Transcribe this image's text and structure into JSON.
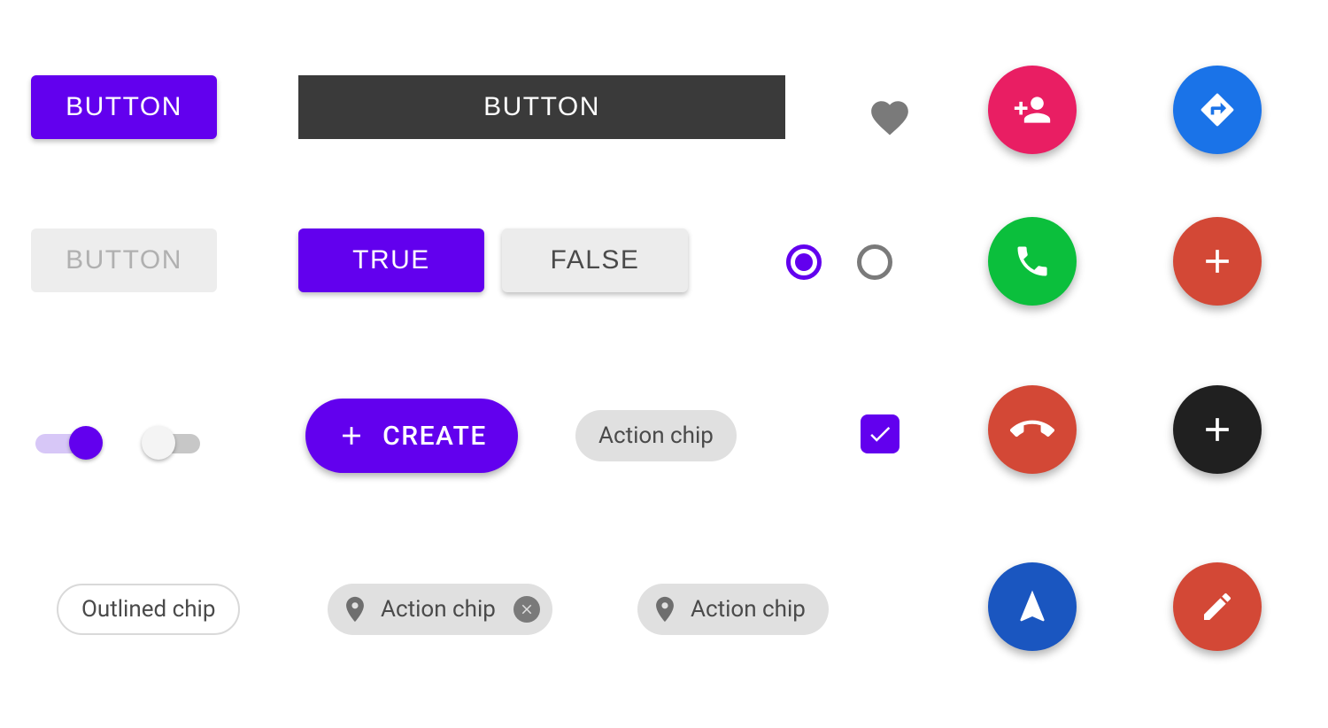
{
  "colors": {
    "primary": "#6200ee",
    "dark": "#3a3a3a",
    "disabledBg": "#ededed",
    "disabledFg": "#b0b0b0",
    "chip": "#e0e0e0",
    "pink": "#e91e63",
    "blue": "#1a73e8",
    "green": "#0bbf3c",
    "red": "#d34836",
    "black": "#202020",
    "navy": "#1a56c0",
    "grey": "#7a7a7a"
  },
  "row1": {
    "button_contained": "BUTTON",
    "button_dark": "BUTTON"
  },
  "row2": {
    "button_disabled": "BUTTON",
    "segment_true": "TRUE",
    "segment_false": "FALSE"
  },
  "row3": {
    "create_label": "CREATE",
    "action_chip": "Action chip",
    "switch_on": true,
    "switch_off": false,
    "checkbox_checked": true
  },
  "row4": {
    "outlined_chip": "Outlined chip",
    "action_chip_close": "Action chip",
    "action_chip_plain": "Action chip"
  },
  "fabs": {
    "f1_icon": "person-add-icon",
    "f2_icon": "directions-icon",
    "f3_icon": "phone-icon",
    "f4_icon": "plus-icon",
    "f5_icon": "call-end-icon",
    "f6_icon": "plus-icon",
    "f7_icon": "navigation-icon",
    "f8_icon": "edit-icon"
  },
  "radios": {
    "checked": true,
    "unchecked": false
  }
}
